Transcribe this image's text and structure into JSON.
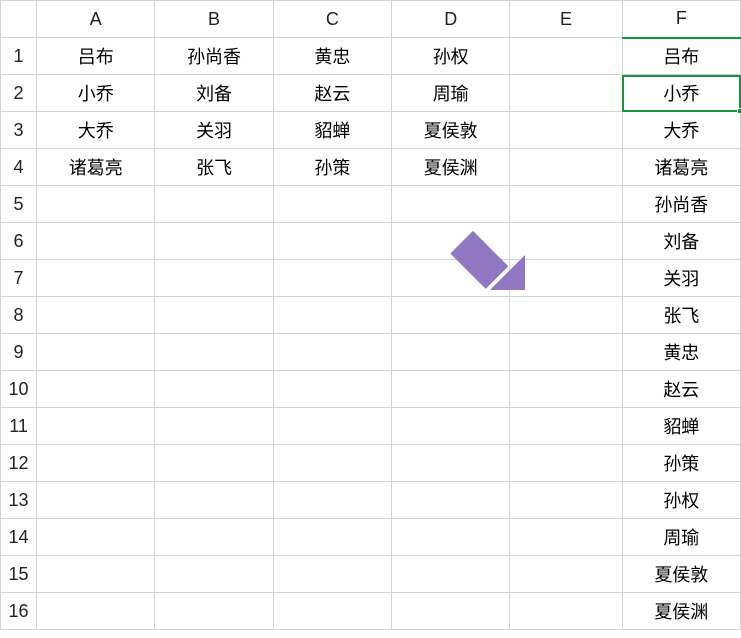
{
  "columns": [
    "A",
    "B",
    "C",
    "D",
    "E",
    "F"
  ],
  "rows": [
    "1",
    "2",
    "3",
    "4",
    "5",
    "6",
    "7",
    "8",
    "9",
    "10",
    "11",
    "12",
    "13",
    "14",
    "15",
    "16"
  ],
  "selected_column": "F",
  "selected_cell": {
    "col": "F",
    "row": "2"
  },
  "grid": {
    "A": {
      "1": "吕布",
      "2": "小乔",
      "3": "大乔",
      "4": "诸葛亮"
    },
    "B": {
      "1": "孙尚香",
      "2": "刘备",
      "3": "关羽",
      "4": "张飞"
    },
    "C": {
      "1": "黄忠",
      "2": "赵云",
      "3": "貂蝉",
      "4": "孙策"
    },
    "D": {
      "1": "孙权",
      "2": "周瑜",
      "3": "夏侯敦",
      "4": "夏侯渊"
    },
    "E": {},
    "F": {
      "1": "吕布",
      "2": "小乔",
      "3": "大乔",
      "4": "诸葛亮",
      "5": "孙尚香",
      "6": "刘备",
      "7": "关羽",
      "8": "张飞",
      "9": "黄忠",
      "10": "赵云",
      "11": "貂蝉",
      "12": "孙策",
      "13": "孙权",
      "14": "周瑜",
      "15": "夏侯敦",
      "16": "夏侯渊"
    }
  },
  "arrow_color": "#9176c1"
}
